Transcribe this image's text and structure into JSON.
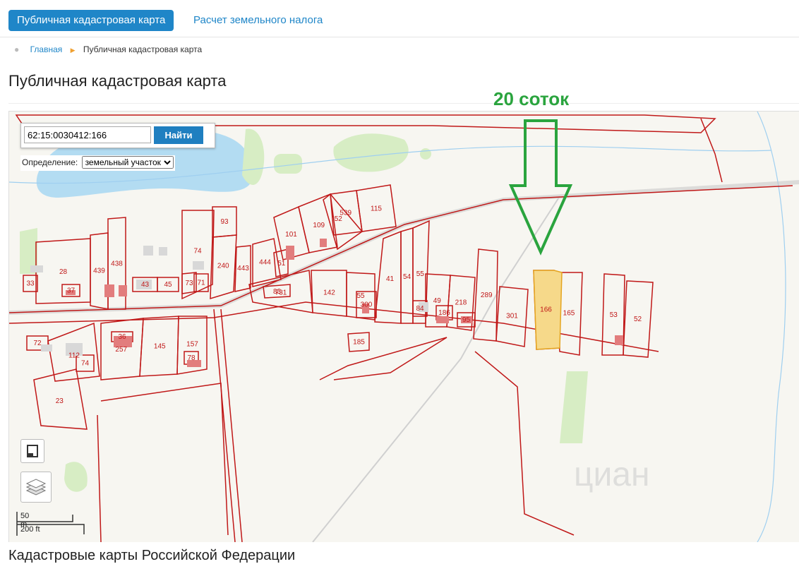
{
  "tabs": {
    "active": "Публичная кадастровая карта",
    "second": "Расчет земельного налога"
  },
  "breadcrumb": {
    "home": "Главная",
    "current": "Публичная кадастровая карта"
  },
  "page_title": "Публичная кадастровая карта",
  "search": {
    "value": "62:15:0030412:166",
    "button": "Найти"
  },
  "definition": {
    "label": "Определение:",
    "selected": "земельный участок"
  },
  "annotation": "20 соток",
  "scale": {
    "metric": "50 m",
    "imperial": "200 ft"
  },
  "bottom_heading": "Кадастровые карты Российской Федерации",
  "watermark": "циан",
  "colors": {
    "parcel_border": "#c01818",
    "highlight": "#f6d98a",
    "water": "#b3dcf2",
    "annotation": "#2aa43e",
    "accent": "#1f86c8"
  },
  "parcels": [
    "539",
    "115",
    "52",
    "109",
    "101",
    "93",
    "74",
    "240",
    "443",
    "444",
    "51",
    "439",
    "438",
    "28",
    "37",
    "33",
    "43",
    "45",
    "73",
    "71",
    "731",
    "142",
    "55",
    "300",
    "41",
    "54",
    "55",
    "84",
    "49",
    "186",
    "218",
    "95",
    "289",
    "301",
    "166",
    "165",
    "53",
    "52",
    "112",
    "257",
    "36",
    "145",
    "157",
    "78",
    "72",
    "74",
    "185",
    "23",
    "83"
  ]
}
